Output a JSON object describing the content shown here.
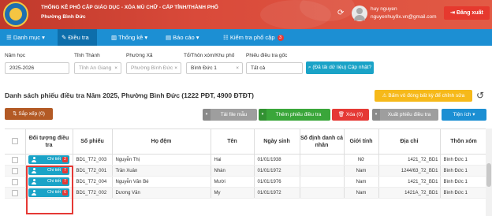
{
  "header": {
    "title": "THỐNG KÊ PHỔ CẬP GIÁO DỤC - XÓA MÙ CHỮ - CẤP TỈNH/THÀNH PHỐ",
    "subtitle": "Phường Bình Đức",
    "user_name": "huy nguyen",
    "user_email": "nguyenhuy9x.vn@gmail.com",
    "logout_label": "Đăng xuất",
    "colors": {
      "header_bg": "#d03a2f",
      "nav_bg": "#1c8fd3",
      "accent": "#1aa3c7",
      "danger": "#e53935"
    }
  },
  "nav": {
    "items": [
      {
        "label": "Danh mục",
        "icon": "list-icon"
      },
      {
        "label": "Điều tra",
        "icon": "edit-icon"
      },
      {
        "label": "Thống kê",
        "icon": "chart-icon"
      },
      {
        "label": "Báo cáo",
        "icon": "report-icon"
      },
      {
        "label": "Kiểm tra phổ cập",
        "icon": "check-icon",
        "badge": "3"
      }
    ]
  },
  "filters": {
    "school_year": {
      "label": "Năm học",
      "value": "2025-2026"
    },
    "province": {
      "label": "Tỉnh Thành",
      "value": "Tỉnh An Giang"
    },
    "ward": {
      "label": "Phường Xã",
      "value": "Phường Bình Đức"
    },
    "hamlet": {
      "label": "Tổ/Thôn xóm/Khu phố",
      "value": "Bình Đức 1"
    },
    "origin": {
      "label": "Phiếu điều tra gốc",
      "value": "Tất cả"
    },
    "search_label": "(Đã tải dữ liệu) Cập nhật?"
  },
  "list": {
    "title": "Danh sách phiếu điều tra Năm 2025, Phường Bình Đức (1222 PĐT, 4900 ĐTĐT)",
    "warning_label": "Bấm vô đóng bất kỳ để chỉnh sửa"
  },
  "toolbar": {
    "sort_label": "Sắp xếp (0)",
    "template_label": "Tải file mẫu",
    "add_label": "Thêm phiếu điều tra",
    "delete_label": "Xóa (0)",
    "export_label": "Xuất phiếu điều tra",
    "utility_label": "Tiện ích"
  },
  "table": {
    "headers": [
      "",
      "Đối tượng điều tra",
      "Số phiếu",
      "Họ đệm",
      "Tên",
      "Ngày sinh",
      "Số định danh cá nhân",
      "Giới tính",
      "Địa chỉ",
      "Thôn xóm"
    ],
    "detail_label": "Chi tiết",
    "rows": [
      {
        "badge": "2",
        "so_phieu": "BD1_T72_003",
        "ho_dem": "Nguyễn Thị",
        "ten": "Hai",
        "ngay_sinh": "01/01/1938",
        "dinh_danh": "",
        "gioi_tinh": "Nữ",
        "dia_chi": "1421_72_BD1",
        "thon_xom": "Bình Đức 1"
      },
      {
        "badge": "7",
        "so_phieu": "BD1_T72_001",
        "ho_dem": "Trần Xuân",
        "ten": "Nhàn",
        "ngay_sinh": "01/01/1972",
        "dinh_danh": "",
        "gioi_tinh": "Nam",
        "dia_chi": "1244/63_72_BD1",
        "thon_xom": "Bình Đức 1"
      },
      {
        "badge": "7",
        "so_phieu": "BD1_T72_004",
        "ho_dem": "Nguyễn Văn Bé",
        "ten": "Mười",
        "ngay_sinh": "01/01/1976",
        "dinh_danh": "",
        "gioi_tinh": "Nam",
        "dia_chi": "1421_72_BD1",
        "thon_xom": "Bình Đức 1"
      },
      {
        "badge": "6",
        "so_phieu": "BD1_T72_002",
        "ho_dem": "Dương Văn",
        "ten": "My",
        "ngay_sinh": "01/01/1972",
        "dinh_danh": "",
        "gioi_tinh": "Nam",
        "dia_chi": "1421A_72_BD1",
        "thon_xom": "Bình Đức 1"
      }
    ]
  }
}
